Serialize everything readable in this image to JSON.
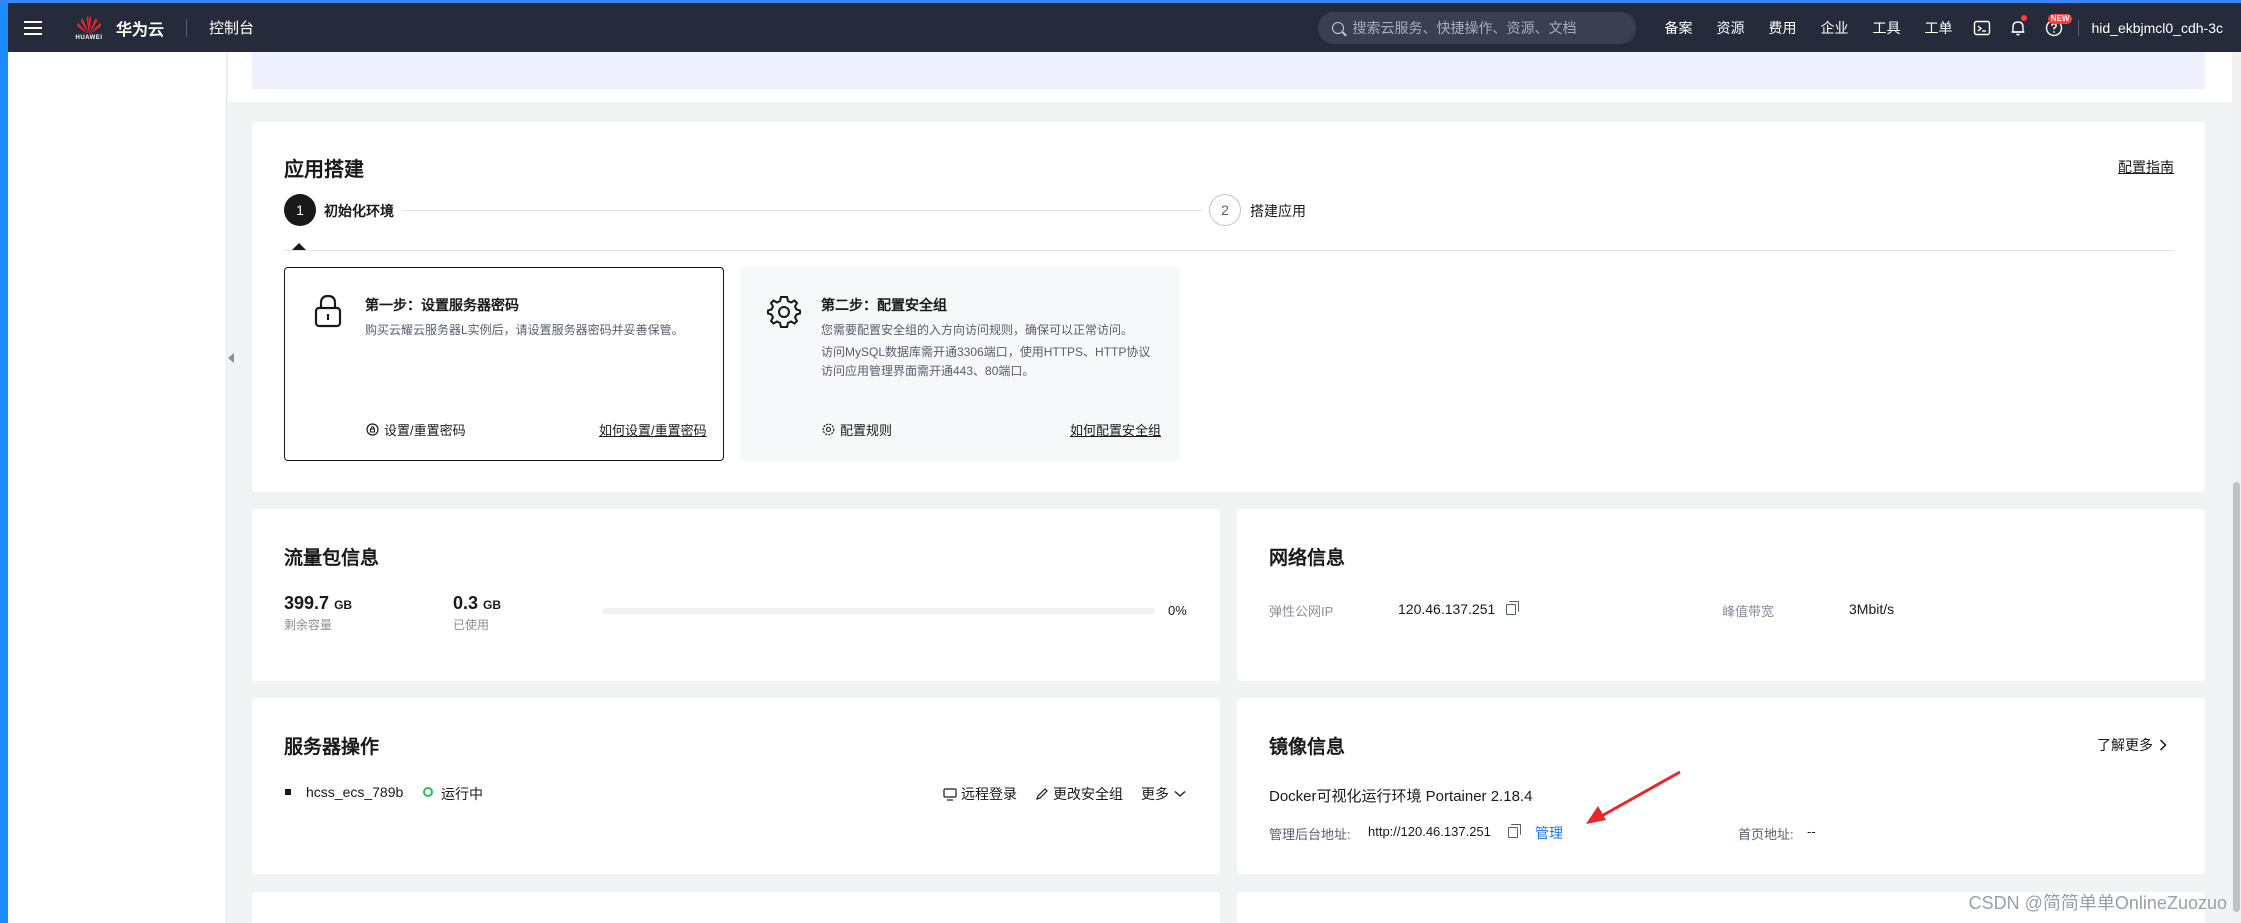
{
  "topbar": {
    "logo_text": "华为云",
    "logo_small": "HUAWEI",
    "console_label": "控制台",
    "search_placeholder": "搜索云服务、快捷操作、资源、文档",
    "nav_items": [
      "备案",
      "资源",
      "费用",
      "企业",
      "工具",
      "工单"
    ],
    "new_badge": "NEW",
    "user_name": "hid_ekbjmcl0_cdh-3c"
  },
  "app_build": {
    "title": "应用搭建",
    "guide_link": "配置指南",
    "steps": [
      {
        "number": "1",
        "label": "初始化环境"
      },
      {
        "number": "2",
        "label": "搭建应用"
      }
    ],
    "cards": [
      {
        "title": "第一步：设置服务器密码",
        "desc_lines": [
          "购买云耀云服务器L实例后，请设置服务器密码并妥善保管。"
        ],
        "action": "设置/重置密码",
        "link": "如何设置/重置密码",
        "icon": "lock-icon"
      },
      {
        "title": "第二步：配置安全组",
        "desc_lines": [
          "您需要配置安全组的入方向访问规则，确保可以正常访问。",
          "访问MySQL数据库需开通3306端口，使用HTTPS、HTTP协议",
          "访问应用管理界面需开通443、80端口。"
        ],
        "action": "配置规则",
        "link": "如何配置安全组",
        "icon": "gear-icon"
      }
    ]
  },
  "traffic": {
    "title": "流量包信息",
    "remaining_value": "399.7",
    "remaining_unit": "GB",
    "remaining_label": "剩余容量",
    "used_value": "0.3",
    "used_unit": "GB",
    "used_label": "已使用",
    "used_percent": 0,
    "percent_text": "0%"
  },
  "network": {
    "title": "网络信息",
    "ip_label": "弹性公网IP",
    "ip_value": "120.46.137.251",
    "bandwidth_label": "峰值带宽",
    "bandwidth_value": "3Mbit/s"
  },
  "server_ops": {
    "title": "服务器操作",
    "server_name": "hcss_ecs_789b",
    "status": "运行中",
    "remote_login": "远程登录",
    "change_sg": "更改安全组",
    "more": "更多"
  },
  "image_info": {
    "title": "镜像信息",
    "learn_more": "了解更多",
    "image_name": "Docker可视化运行环境 Portainer 2.18.4",
    "admin_label": "管理后台地址:",
    "admin_url": "http://120.46.137.251",
    "manage_link": "管理",
    "home_label": "首页地址:",
    "home_value": "--"
  },
  "watermark": "CSDN @简简单单OnlineZuozuo",
  "colors": {
    "topbar": "#252b3a",
    "accent_blue": "#1476ff",
    "status_green": "#2bbf4a",
    "annotation_red": "#e8262c"
  }
}
